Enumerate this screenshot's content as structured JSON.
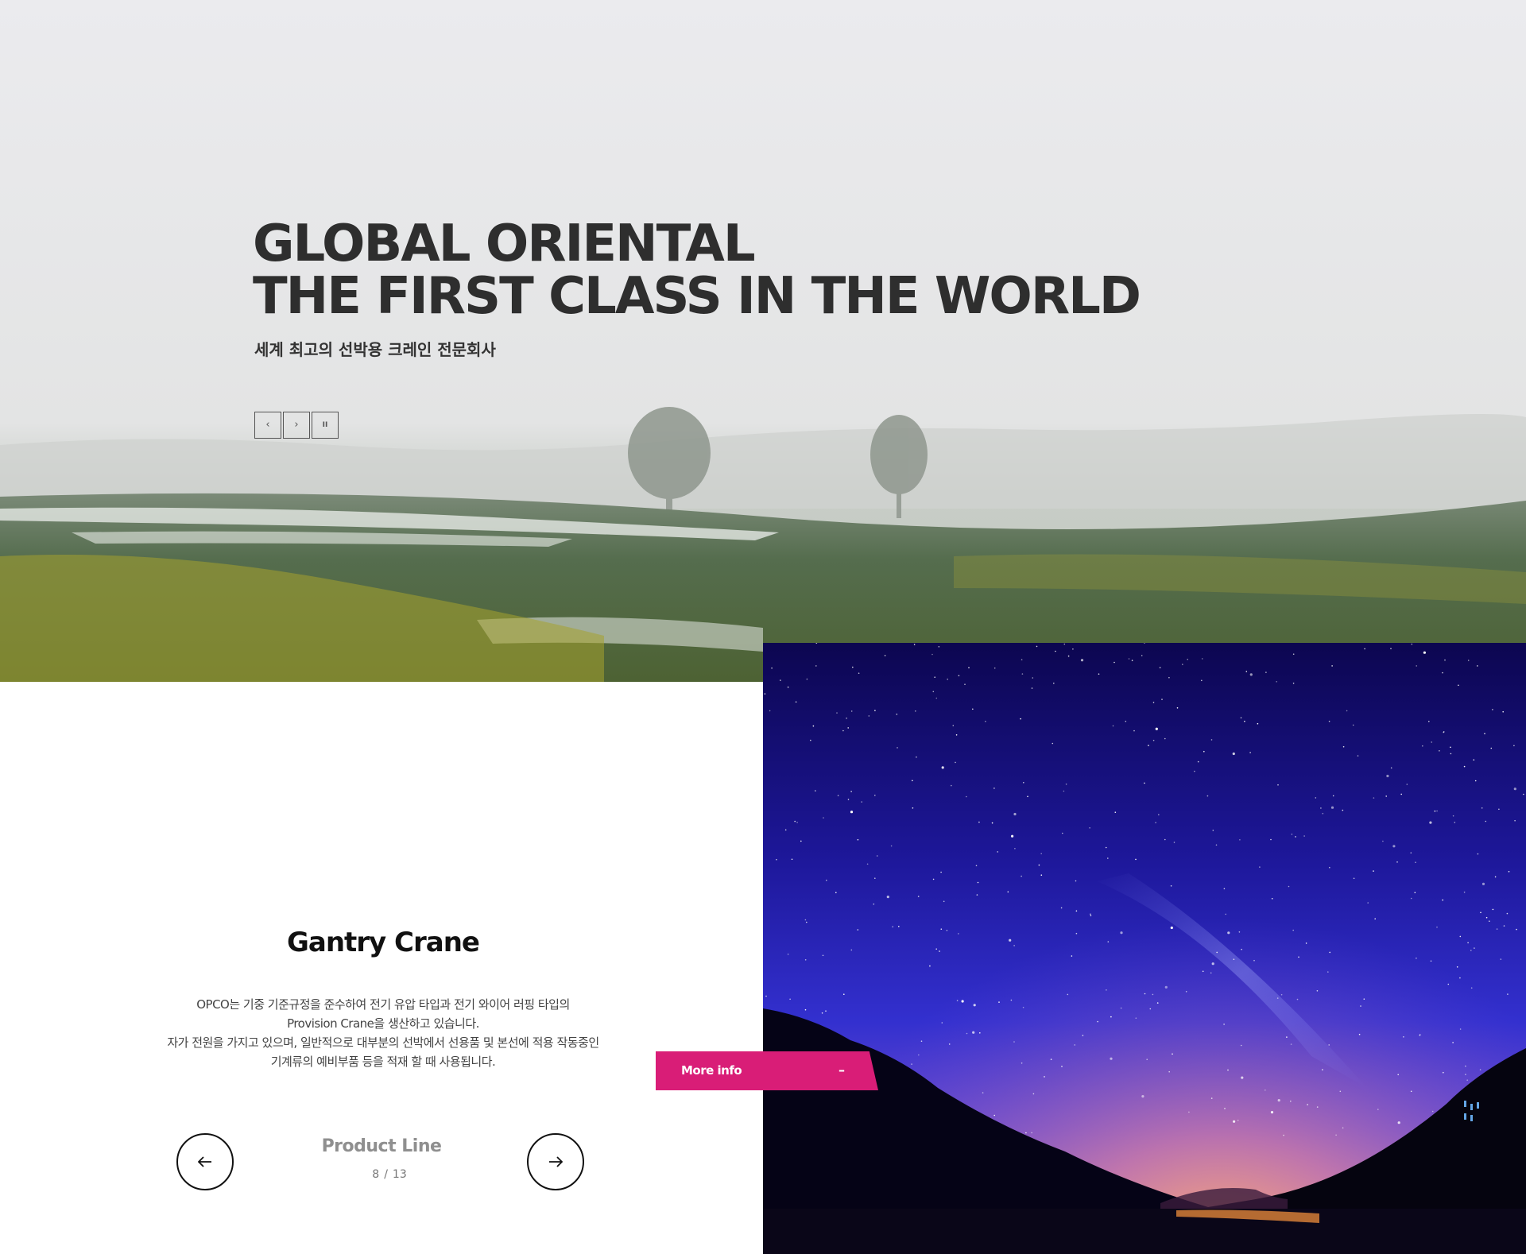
{
  "hero": {
    "title_line1": "GLOBAL ORIENTAL",
    "title_line2": "THE FIRST CLASS IN THE WORLD",
    "subtitle": "세계 최고의 선박용 크레인 전문회사",
    "controls": {
      "prev_icon": "‹",
      "next_icon": "›",
      "pause_icon": "II"
    },
    "background_image": "foggy-snowy-field-with-trees"
  },
  "product": {
    "title": "Gantry Crane",
    "description": [
      "OPCO는 기중 기준규정을 준수하여 전기 유압 타입과 전기 와이어 러핑 타입의",
      "Provision Crane을 생산하고 있습니다.",
      "자가 전원을 가지고 있으며, 일반적으로 대부분의 선박에서 선용품 및 본선에 적용 작동중인",
      "기계류의 예비부품 등을 적재 할 때 사용됩니다."
    ],
    "pager": {
      "label": "Product Line",
      "current": "8",
      "separator": "/",
      "total": "13"
    },
    "prev_icon": "arrow-left-icon",
    "next_icon": "arrow-right-icon"
  },
  "more_info": {
    "label": "More info",
    "icon": "–"
  },
  "side_image": "night-sky-milky-way-over-lake",
  "colors": {
    "accent": "#d91d77",
    "heading": "#2e2e2e",
    "pager_label": "#8f8f8f",
    "sky_top": "#12095e",
    "sky_mid": "#2c25c4"
  }
}
